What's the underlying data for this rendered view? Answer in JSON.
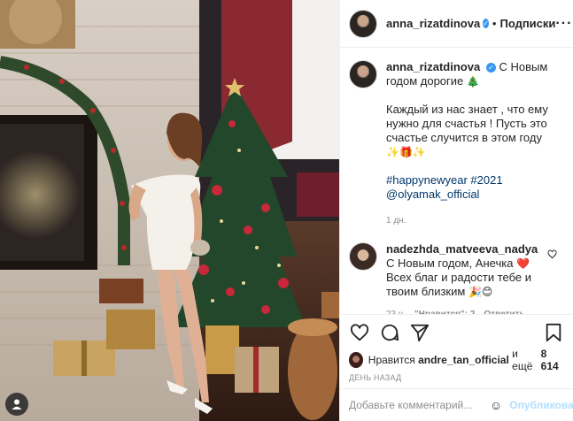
{
  "header": {
    "username": "anna_rizatdinova",
    "separator": "•",
    "follow_label": "Подписки",
    "more_label": "···"
  },
  "caption": {
    "username": "anna_rizatdinova",
    "line1": "С Новым годом дорогие",
    "line1_emoji": "🎄",
    "paragraph": "Каждый из нас знает , что ему нужно для счастья ! Пусть это счастье случится в этом году",
    "paragraph_emoji": "✨🎁✨",
    "hashtags": "#happynewyear #2021",
    "mention": "@olyamak_official",
    "time": "1 дн."
  },
  "comment": {
    "username": "nadezhda_matveeva_nadya",
    "text": "С Новым годом, Анечка",
    "text_emoji": "❤️",
    "text2": "Всех благ и радости тебе и твоим близким",
    "text2_emoji": "🎉😊",
    "time": "23 ч.",
    "likes": "\"Нравится\": 2",
    "reply": "Ответить"
  },
  "likes": {
    "prefix": "Нравится",
    "user": "andre_tan_official",
    "suffix": "и ещё",
    "count": "8 614"
  },
  "post_date": "ДЕНЬ НАЗАД",
  "add_comment": {
    "placeholder": "Добавьте комментарий...",
    "emoji_icon": "☺",
    "publish_label": "Опубликовать"
  },
  "icons": {
    "like": "heart-icon",
    "comment": "comment-icon",
    "share": "share-icon",
    "save": "bookmark-icon",
    "verified": "verified-icon"
  },
  "colors": {
    "link": "#00376b",
    "verified": "#3897f0",
    "publish_disabled": "#b2dffc",
    "muted": "#8e8e8e"
  }
}
